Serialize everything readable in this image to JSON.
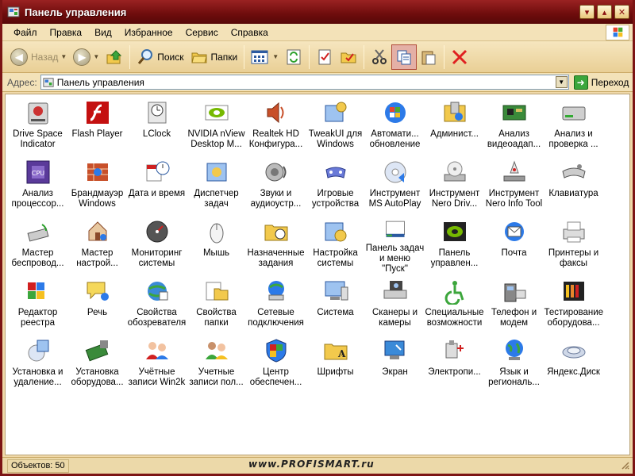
{
  "window": {
    "title": "Панель управления"
  },
  "menu": [
    "Файл",
    "Правка",
    "Вид",
    "Избранное",
    "Сервис",
    "Справка"
  ],
  "toolbar": {
    "back": "Назад",
    "search": "Поиск",
    "folders": "Папки"
  },
  "address": {
    "label": "Адрес:",
    "value": "Панель управления",
    "go": "Переход"
  },
  "items": [
    {
      "label": "Drive Space Indicator",
      "icon": "drive-space-icon"
    },
    {
      "label": "Flash Player",
      "icon": "flash-icon"
    },
    {
      "label": "LClock",
      "icon": "clock-icon"
    },
    {
      "label": "NVIDIA nView Desktop M...",
      "icon": "nvidia-icon"
    },
    {
      "label": "Realtek HD Конфигура...",
      "icon": "speaker-icon"
    },
    {
      "label": "TweakUI для Windows",
      "icon": "tweakui-icon"
    },
    {
      "label": "Автомати... обновление",
      "icon": "windows-update-icon"
    },
    {
      "label": "Админист...",
      "icon": "admin-tools-icon"
    },
    {
      "label": "Анализ видеоадап...",
      "icon": "video-adapter-icon"
    },
    {
      "label": "Анализ и проверка ...",
      "icon": "hard-drive-icon"
    },
    {
      "label": "Анализ процессор...",
      "icon": "cpuz-icon"
    },
    {
      "label": "Брандмауэр Windows",
      "icon": "firewall-icon"
    },
    {
      "label": "Дата и время",
      "icon": "datetime-icon"
    },
    {
      "label": "Диспетчер задач",
      "icon": "task-manager-icon"
    },
    {
      "label": "Звуки и аудиоустр...",
      "icon": "sounds-icon"
    },
    {
      "label": "Игровые устройства",
      "icon": "gamepad-icon"
    },
    {
      "label": "Инструмент MS AutoPlay",
      "icon": "autoplay-icon"
    },
    {
      "label": "Инструмент Nero Driv...",
      "icon": "nero-drive-icon"
    },
    {
      "label": "Инструмент Nero Info Tool",
      "icon": "nero-info-icon"
    },
    {
      "label": "Клавиатура",
      "icon": "keyboard-icon"
    },
    {
      "label": "Мастер беспровод...",
      "icon": "wireless-icon"
    },
    {
      "label": "Мастер настрой...",
      "icon": "network-setup-icon"
    },
    {
      "label": "Мониторинг системы",
      "icon": "monitoring-icon"
    },
    {
      "label": "Мышь",
      "icon": "mouse-icon"
    },
    {
      "label": "Назначенные задания",
      "icon": "scheduled-tasks-icon"
    },
    {
      "label": "Настройка системы",
      "icon": "system-config-icon"
    },
    {
      "label": "Панель задач и меню \"Пуск\"",
      "icon": "taskbar-icon"
    },
    {
      "label": "Панель управлен...",
      "icon": "nvidia-panel-icon"
    },
    {
      "label": "Почта",
      "icon": "mail-icon"
    },
    {
      "label": "Принтеры и факсы",
      "icon": "printer-icon"
    },
    {
      "label": "Редактор реестра",
      "icon": "registry-icon"
    },
    {
      "label": "Речь",
      "icon": "speech-icon"
    },
    {
      "label": "Свойства обозревателя",
      "icon": "internet-options-icon"
    },
    {
      "label": "Свойства папки",
      "icon": "folder-options-icon"
    },
    {
      "label": "Сетевые подключения",
      "icon": "network-icon"
    },
    {
      "label": "Система",
      "icon": "system-icon"
    },
    {
      "label": "Сканеры и камеры",
      "icon": "scanner-icon"
    },
    {
      "label": "Специальные возможности",
      "icon": "accessibility-icon"
    },
    {
      "label": "Телефон и модем",
      "icon": "phone-modem-icon"
    },
    {
      "label": "Тестирование оборудова...",
      "icon": "hardware-test-icon"
    },
    {
      "label": "Установка и удаление...",
      "icon": "add-remove-icon"
    },
    {
      "label": "Установка оборудова...",
      "icon": "add-hardware-icon"
    },
    {
      "label": "Учётные записи Win2k",
      "icon": "user-accounts-icon"
    },
    {
      "label": "Учетные записи пол...",
      "icon": "users-icon"
    },
    {
      "label": "Центр обеспечен...",
      "icon": "security-center-icon"
    },
    {
      "label": "Шрифты",
      "icon": "fonts-icon"
    },
    {
      "label": "Экран",
      "icon": "display-icon"
    },
    {
      "label": "Электропи...",
      "icon": "power-icon"
    },
    {
      "label": "Язык и региональ...",
      "icon": "regional-icon"
    },
    {
      "label": "Яндекс.Диск",
      "icon": "yandex-disk-icon"
    }
  ],
  "status": {
    "objects": "Объектов: 50"
  },
  "watermark": "www.PROFISMART.ru",
  "colors": {
    "titlebar": "#7c1414",
    "chrome": "#f0d9a9",
    "content": "#ffffff"
  }
}
